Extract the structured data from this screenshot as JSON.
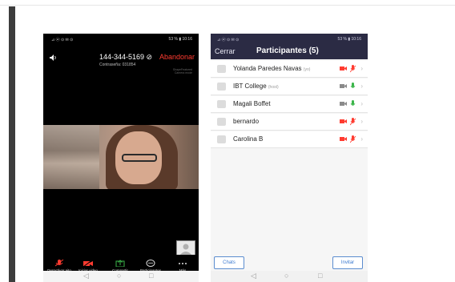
{
  "meeting": {
    "status_left": "⊿ ⓦ ⊙ ✉ ⊙",
    "status_right": "53 % ▮ 10:16",
    "meeting_id": "144-344-5169 ⊘",
    "password": "Contraseña: 031854",
    "leave_label": "Abandonar",
    "brand_text": "ShapeFeatured Camera mode",
    "toolbar": [
      {
        "label": "Desactivar aito",
        "icon": "mic-muted-icon"
      },
      {
        "label": "Iniciar video",
        "icon": "video-off-icon"
      },
      {
        "label": "Compartir",
        "icon": "share-icon"
      },
      {
        "label": "Participantes",
        "icon": "participants-icon"
      },
      {
        "label": "Más",
        "icon": "more-icon"
      }
    ]
  },
  "participants": {
    "status_left": "⊿ ⓦ ⊙ ✉ ⊙",
    "status_right": "53 % ▮ 10:16",
    "close_label": "Cerrar",
    "title": "Participantes (5)",
    "list": [
      {
        "name": "Yolanda Paredes Navas",
        "tag": "(yo)",
        "mic_on": false
      },
      {
        "name": "IBT College",
        "tag": "(host)",
        "mic_on": true
      },
      {
        "name": "Magali Boffet",
        "tag": "",
        "mic_on": true
      },
      {
        "name": "bernardo",
        "tag": "",
        "mic_on": false
      },
      {
        "name": "Carolina B",
        "tag": "",
        "mic_on": false
      }
    ],
    "chats_label": "Chats",
    "invite_label": "Invitar"
  },
  "android_nav": {
    "back": "◁",
    "home": "○",
    "recents": "□"
  },
  "colors": {
    "accent_red": "#ff3b30",
    "header_bg": "#2b2b44",
    "link_blue": "#3d7bd0",
    "mic_green": "#3bb54a"
  }
}
